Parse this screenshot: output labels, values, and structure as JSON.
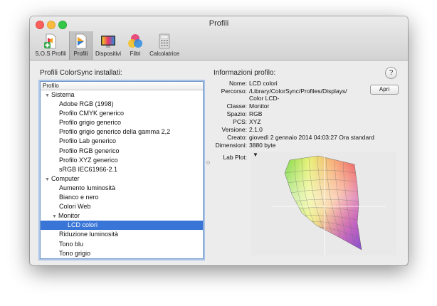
{
  "window": {
    "title": "Profili"
  },
  "toolbar": {
    "items": [
      {
        "label": "S.O.S Profili",
        "icon": "first-aid-document-icon"
      },
      {
        "label": "Profili",
        "icon": "profile-document-icon"
      },
      {
        "label": "Dispositivi",
        "icon": "display-icon"
      },
      {
        "label": "Filtri",
        "icon": "color-circles-icon"
      },
      {
        "label": "Calcolatrice",
        "icon": "calculator-icon"
      }
    ],
    "selected": "Profili"
  },
  "left_panel": {
    "title": "Profili ColorSync installati:",
    "column_header": "Profilo",
    "rows": [
      {
        "label": "Sistema",
        "disclosure": "▼"
      },
      {
        "label": "Adobe RGB (1998)"
      },
      {
        "label": "Profilo CMYK generico"
      },
      {
        "label": "Profilo grigio generico"
      },
      {
        "label": "Profilo grigio generico della gamma 2,2"
      },
      {
        "label": "Profilo Lab generico"
      },
      {
        "label": "Profilo RGB generico"
      },
      {
        "label": "Profilo XYZ generico"
      },
      {
        "label": "sRGB IEC61966-2.1"
      },
      {
        "label": "Computer",
        "disclosure": "▼"
      },
      {
        "label": "Aumento luminosità"
      },
      {
        "label": "Bianco e nero"
      },
      {
        "label": "Colori Web"
      },
      {
        "label": "Monitor",
        "disclosure": "▼"
      },
      {
        "label": "LCD colori",
        "selected": true
      },
      {
        "label": "Riduzione luminosità"
      },
      {
        "label": "Tono blu"
      },
      {
        "label": "Tono grigio"
      }
    ]
  },
  "right_panel": {
    "title": "Informazioni profilo:",
    "help": "?",
    "open_button": "Apri",
    "fields": [
      {
        "label": "Nome:",
        "value": "LCD colori"
      },
      {
        "label": "Percorso:",
        "value": "/Library/ColorSync/Profiles/Displays/",
        "value2": "Color LCD-"
      },
      {
        "label": "Classe:",
        "value": "Monitor"
      },
      {
        "label": "Spazio:",
        "value": "RGB"
      },
      {
        "label": "PCS:",
        "value": "XYZ"
      },
      {
        "label": "Versione:",
        "value": "2.1.0"
      },
      {
        "label": "Creato:",
        "value": "giovedì 2 gennaio 2014 04:03:27 Ora standard"
      },
      {
        "label": "Dimensioni:",
        "value": "3880 byte"
      }
    ],
    "plot_label": "Lab Plot:",
    "plot_menu": "▼"
  }
}
